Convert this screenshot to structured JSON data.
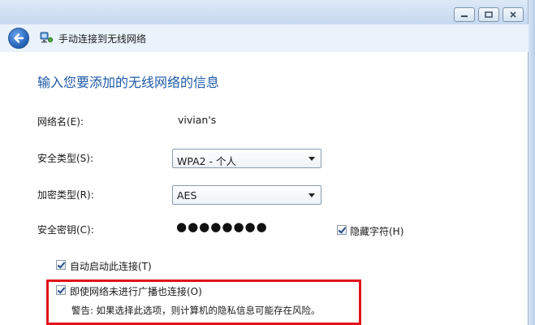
{
  "window": {
    "controls": [
      "minimize-icon",
      "maximize-icon",
      "close-icon"
    ]
  },
  "nav": {
    "title": "手动连接到无线网络"
  },
  "form": {
    "heading": "输入您要添加的无线网络的信息",
    "network_name_label": "网络名(E):",
    "network_name_value": "vivian's",
    "security_type_label": "安全类型(S):",
    "security_type_value": "WPA2 - 个人",
    "encryption_type_label": "加密类型(R):",
    "encryption_type_value": "AES",
    "security_key_label": "安全密钥(C):",
    "security_key_value": "●●●●●●●●",
    "hide_chars_label": "隐藏字符(H)",
    "auto_connect_label": "自动启动此连接(T)",
    "connect_hidden_label": "即使网络未进行广播也连接(O)",
    "warning_text": "警告: 如果选择此选项，则计算机的隐私信息可能存在风险。"
  },
  "colors": {
    "heading_blue": "#1e5aa8",
    "highlight_red": "#e0141a"
  }
}
